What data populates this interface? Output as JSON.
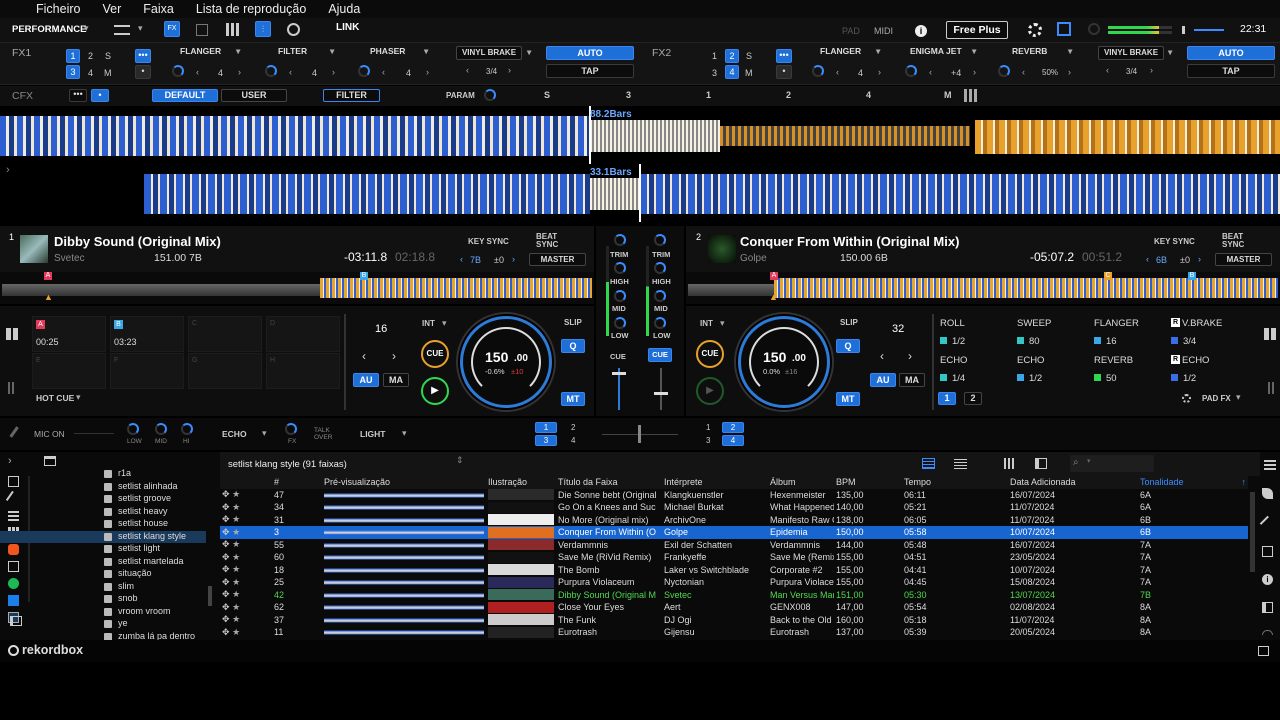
{
  "menu": [
    "Ficheiro",
    "Ver",
    "Faixa",
    "Lista de reprodução",
    "Ajuda"
  ],
  "topbar": {
    "mode": "PERFORMANCE",
    "link": "LINK",
    "pad": "PAD",
    "midi": "MIDI",
    "plan": "Free Plus",
    "time": "22:31"
  },
  "fx1": {
    "label": "FX1",
    "ch": [
      "1",
      "2",
      "S",
      "3",
      "4",
      "M"
    ],
    "effects": [
      {
        "name": "FLANGER",
        "val": "4"
      },
      {
        "name": "FILTER",
        "val": "4"
      },
      {
        "name": "PHASER",
        "val": "4"
      }
    ],
    "beat": "VINYL BRAKE",
    "beat_val": "3/4",
    "auto": "AUTO",
    "tap": "TAP"
  },
  "fx2": {
    "label": "FX2",
    "ch": [
      "1",
      "2",
      "S",
      "3",
      "4",
      "M"
    ],
    "effects": [
      {
        "name": "FLANGER",
        "val": "4"
      },
      {
        "name": "ENIGMA JET",
        "val": "+4"
      },
      {
        "name": "REVERB",
        "val": "50%"
      }
    ],
    "beat": "VINYL BRAKE",
    "beat_val": "3/4",
    "auto": "AUTO",
    "tap": "TAP"
  },
  "cfx": {
    "label": "CFX",
    "default": "DEFAULT",
    "user": "USER",
    "filter": "FILTER",
    "param": "PARAM",
    "s": "S",
    "n3": "3",
    "n1": "1",
    "n2": "2",
    "n4": "4",
    "m": "M"
  },
  "waveform": {
    "bars1": "88.2Bars",
    "bars2": "33.1Bars"
  },
  "deck1": {
    "num": "1",
    "title": "Dibby Sound (Original Mix)",
    "artist": "Svetec",
    "bpm_key": "151.00 7B",
    "remain": "-03:11.8",
    "elapsed": "02:18.8",
    "keysync": "KEY SYNC",
    "beatsync": "BEAT SYNC",
    "key": "7B",
    "pitch": "±0",
    "master": "MASTER",
    "cues": [
      {
        "l": "A",
        "t": "00:25"
      },
      {
        "l": "B",
        "t": "03:23"
      },
      {
        "l": "C",
        "t": ""
      },
      {
        "l": "D",
        "t": ""
      },
      {
        "l": "E",
        "t": ""
      },
      {
        "l": "F",
        "t": ""
      },
      {
        "l": "G",
        "t": ""
      },
      {
        "l": "H",
        "t": ""
      }
    ],
    "loop": "16",
    "int": "INT",
    "cue": "CUE",
    "slip": "SLIP",
    "q": "Q",
    "au": "AU",
    "ma": "MA",
    "mt": "MT",
    "bpm": "150",
    "bpm_dec": ".00",
    "pct": "-0.6%",
    "pm": "±10",
    "hotcue": "HOT CUE"
  },
  "deck2": {
    "num": "2",
    "title": "Conquer From Within (Original Mix)",
    "artist": "Golpe",
    "bpm_key": "150.00 6B",
    "remain": "-05:07.2",
    "elapsed": "00:51.2",
    "keysync": "KEY SYNC",
    "beatsync": "BEAT SYNC",
    "key": "6B",
    "pitch": "±0",
    "master": "MASTER",
    "loop": "32",
    "int": "INT",
    "cue": "CUE",
    "slip": "SLIP",
    "q": "Q",
    "au": "AU",
    "ma": "MA",
    "mt": "MT",
    "bpm": "150",
    "bpm_dec": ".00",
    "pct": "0.0%",
    "pm": "±16",
    "padfx": "PAD FX",
    "page1": "1",
    "page2": "2",
    "pads": [
      {
        "n": "ROLL",
        "v": "1/2",
        "c": "#34c5c5"
      },
      {
        "n": "SWEEP",
        "v": "80",
        "c": "#34c5c5"
      },
      {
        "n": "FLANGER",
        "v": "16",
        "c": "#3aa8e8"
      },
      {
        "n": "V.BRAKE",
        "v": "3/4",
        "c": "#3a6ee8"
      },
      {
        "n": "ECHO",
        "v": "1/4",
        "c": "#34c5c5"
      },
      {
        "n": "ECHO",
        "v": "1/2",
        "c": "#3aa8e8"
      },
      {
        "n": "REVERB",
        "v": "50",
        "c": "#2fd84f"
      },
      {
        "n": "ECHO",
        "v": "1/2",
        "c": "#3a6ee8"
      }
    ]
  },
  "mixer": {
    "trim": "TRIM",
    "high": "HIGH",
    "mid": "MID",
    "low": "LOW",
    "cue": "CUE"
  },
  "bottombar": {
    "mic": "MIC ON",
    "low": "LOW",
    "mid": "MID",
    "hi": "HI",
    "echo": "ECHO",
    "fx": "FX",
    "talk": "TALK OVER",
    "light": "LIGHT",
    "a1": "1",
    "a2": "2",
    "a3": "3",
    "a4": "4",
    "b1": "1",
    "b2": "2",
    "b3": "3",
    "b4": "4"
  },
  "browser": {
    "playlist": "setlist klang style (91 faixas)",
    "cols": [
      "#",
      "Pré-visualização",
      "Ilustração",
      "Título da Faixa",
      "Intérprete",
      "Álbum",
      "BPM",
      "Tempo",
      "Data Adicionada",
      "Tonalidade"
    ],
    "rows": [
      [
        "47",
        "Die Sonne bebt (Original",
        "Klangkuenstler",
        "Hexenmeister",
        "135,00",
        "06:11",
        "16/07/2024",
        "6A"
      ],
      [
        "34",
        "Go On a Knees and Suc",
        "Michael Burkat",
        "What Happened ?",
        "140,00",
        "05:21",
        "11/07/2024",
        "6A"
      ],
      [
        "31",
        "No More (Original mix)",
        "ArchivOne",
        "Manifesto Raw Culture V",
        "138,00",
        "06:05",
        "11/07/2024",
        "6B"
      ],
      [
        "3",
        "Conquer From Within (O",
        "Golpe",
        "Epidemia",
        "150,00",
        "05:58",
        "10/07/2024",
        "6B"
      ],
      [
        "55",
        "Verdammnis",
        "Exil der Schatten",
        "Verdammnis",
        "144,00",
        "05:48",
        "16/07/2024",
        "7A"
      ],
      [
        "60",
        "Save Me (RiVid Remix)",
        "Frankyeffe",
        "Save Me (Remixes)",
        "155,00",
        "04:51",
        "23/05/2024",
        "7A"
      ],
      [
        "18",
        "The Bomb",
        "Laker vs Switchblade",
        "Corporate #2",
        "155,00",
        "04:41",
        "10/07/2024",
        "7A"
      ],
      [
        "25",
        "Purpura Violaceum",
        "Nyctonian",
        "Purpura Violaceum",
        "155,00",
        "04:45",
        "15/08/2024",
        "7A"
      ],
      [
        "42",
        "Dibby Sound (Original M",
        "Svetec",
        "Man Versus Man EP",
        "151,00",
        "05:30",
        "13/07/2024",
        "7B"
      ],
      [
        "62",
        "Close Your Eyes",
        "Aert",
        "GENX008",
        "147,00",
        "05:54",
        "02/08/2024",
        "8A"
      ],
      [
        "37",
        "The Funk",
        "DJ Ogi",
        "Back to the Old School",
        "160,00",
        "05:18",
        "11/07/2024",
        "8A"
      ],
      [
        "11",
        "Eurotrash",
        "Gijensu",
        "Eurotrash",
        "137,00",
        "05:39",
        "20/05/2024",
        "8A"
      ]
    ],
    "sidebar": [
      "r1a",
      "setlist alinhada",
      "setlist groove",
      "setlist heavy",
      "setlist house",
      "setlist klang style",
      "setlist light",
      "setlist martelada",
      "situação",
      "slim",
      "snob",
      "vroom vroom",
      "ye",
      "zumba lá pa dentro"
    ]
  },
  "footer": {
    "logo": "rekordbox"
  }
}
